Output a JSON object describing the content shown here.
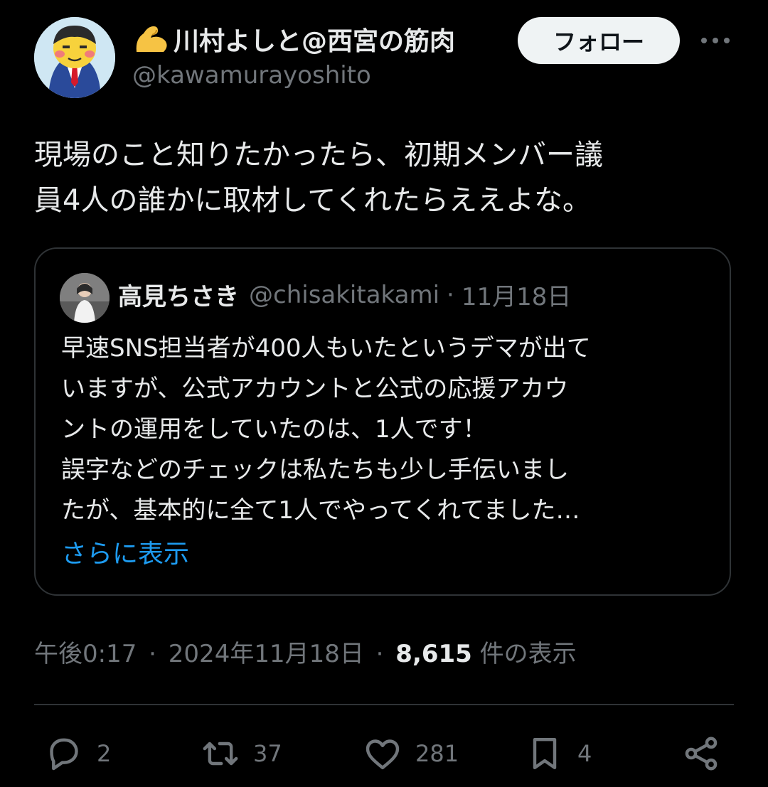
{
  "author": {
    "name": "川村よしと@西宮の筋肉",
    "handle": "@kawamurayoshito",
    "follow_label": "フォロー"
  },
  "post": {
    "text_line1": "現場のこと知りたかったら、初期メンバー議",
    "text_line2": "員4人の誰かに取材してくれたらええよな。"
  },
  "quote": {
    "name": "高見ちさき",
    "handle": "@chisakitakami",
    "sep": "·",
    "date": "11月18日",
    "lines": [
      "早速SNS担当者が400人もいたというデマが出て",
      "いますが、公式アカウントと公式の応援アカウ",
      "ントの運用をしていたのは、1人です！",
      "誤字などのチェックは私たちも少し手伝いまし",
      "たが、基本的に全て1人でやってくれてました…"
    ],
    "show_more": "さらに表示"
  },
  "meta": {
    "time": "午後0:17",
    "sep1": "·",
    "date": "2024年11月18日",
    "sep2": "·",
    "views_count": "8,615",
    "views_label": "件の表示"
  },
  "actions": {
    "replies": "2",
    "reposts": "37",
    "likes": "281",
    "bookmarks": "4"
  },
  "icons": {
    "reply": "reply-icon",
    "repost": "repost-icon",
    "like": "heart-icon",
    "bookmark": "bookmark-icon",
    "share": "share-icon",
    "more": "more-icon",
    "flex": "flexed-biceps-icon"
  },
  "colors": {
    "background": "#000000",
    "text": "#e7e9ea",
    "muted": "#71767b",
    "link": "#1d9bf0",
    "border": "#2f3336",
    "follow_bg": "#eff3f4"
  }
}
